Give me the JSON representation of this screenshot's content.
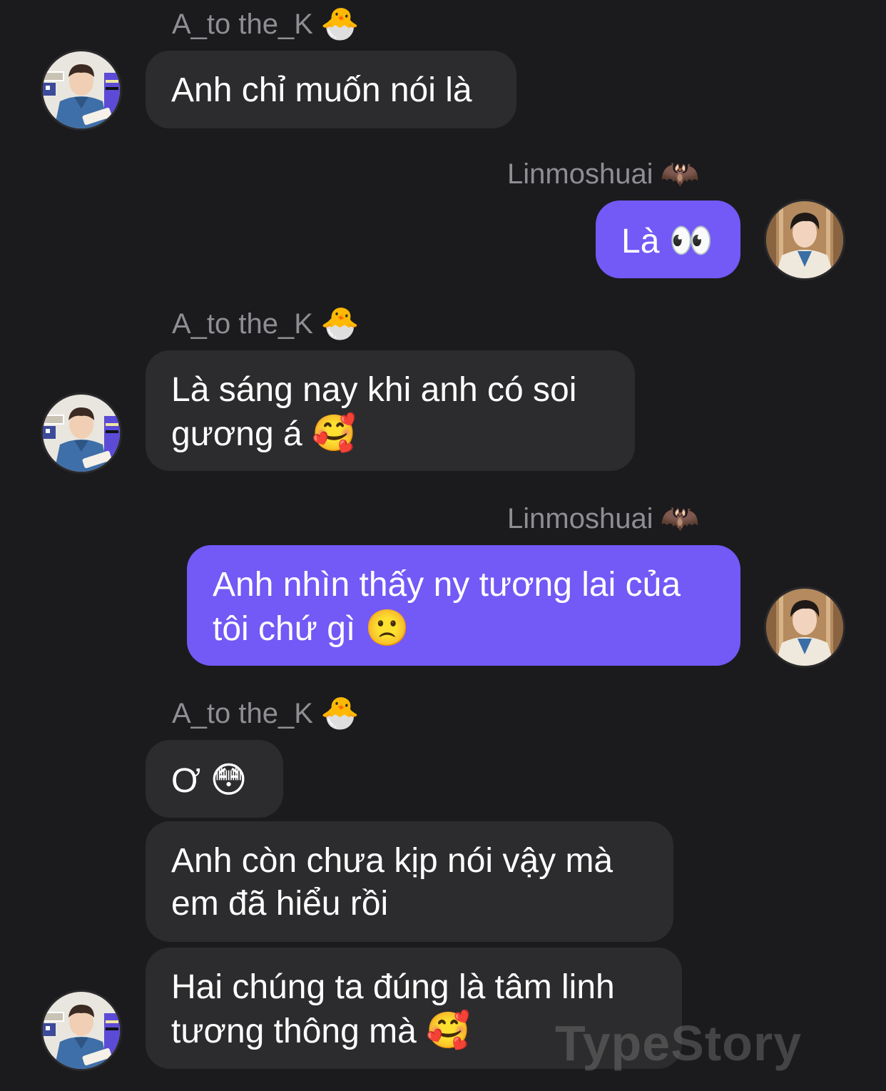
{
  "chat": {
    "left_user": {
      "name": "A_to the_K",
      "badge_emoji": "🐣"
    },
    "right_user": {
      "name": "Linmoshuai",
      "badge_emoji": "🦇"
    },
    "messages": [
      {
        "text": "Anh chỉ muốn nói là",
        "emoji": ""
      },
      {
        "text": "Là ",
        "emoji": "👀"
      },
      {
        "text": "Là sáng nay khi anh có soi\ngương á ",
        "emoji": "🥰"
      },
      {
        "text": "Anh nhìn thấy ny tương lai của\ntôi chứ gì ",
        "emoji": "🙁"
      },
      {
        "text": "Ơ ",
        "emoji": "😳"
      },
      {
        "text": "Anh còn chưa kịp nói vậy mà\nem đã hiểu rồi",
        "emoji": ""
      },
      {
        "text": "Hai chúng ta đúng là tâm linh\ntương thông mà ",
        "emoji": "🥰"
      }
    ]
  },
  "watermark": "TypeStory",
  "colors": {
    "background": "#1b1b1e",
    "incoming_bubble": "#2c2c2e",
    "outgoing_bubble": "#7359f6",
    "sender_name": "#8e8e93"
  }
}
